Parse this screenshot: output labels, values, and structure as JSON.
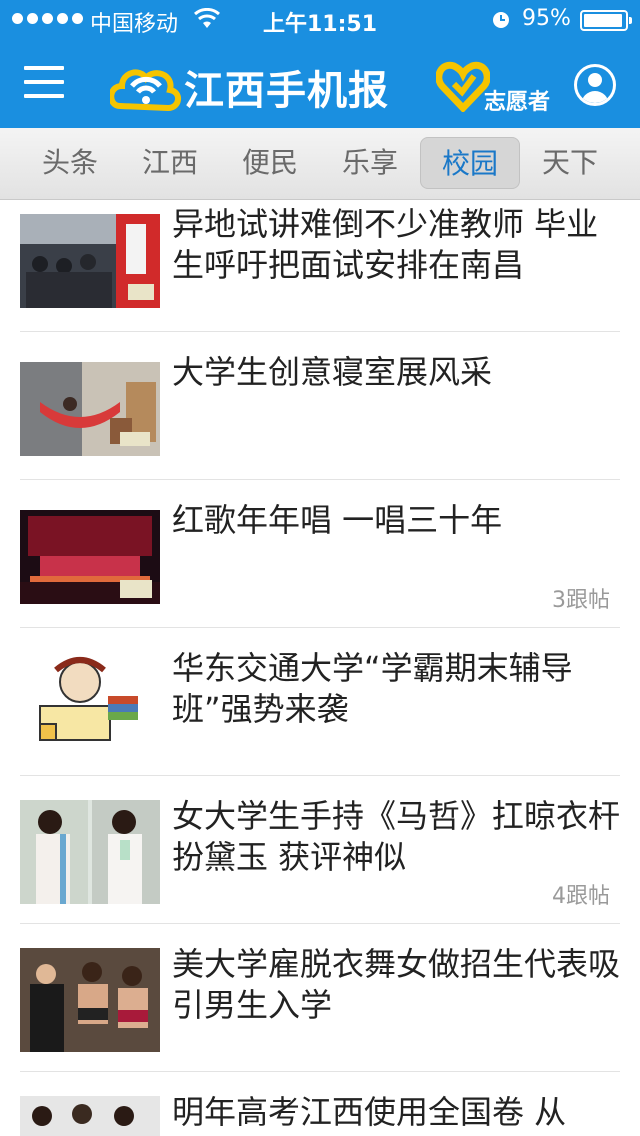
{
  "status_bar": {
    "carrier": "中国移动",
    "time": "上午11:51",
    "battery": "95%",
    "battery_level": 0.95
  },
  "header": {
    "app_name": "江西手机报",
    "volunteer_label": "志愿者",
    "icons": [
      "menu-icon",
      "logo-icon",
      "volunteer-heart-icon",
      "user-icon"
    ],
    "colors": {
      "bar": "#1a8fe0",
      "logo_accent": "#f5c400"
    }
  },
  "tabs": [
    {
      "label": "头条",
      "active": false
    },
    {
      "label": "江西",
      "active": false
    },
    {
      "label": "便民",
      "active": false
    },
    {
      "label": "乐享",
      "active": false
    },
    {
      "label": "校园",
      "active": true
    },
    {
      "label": "天下",
      "active": false
    }
  ],
  "news": [
    {
      "title": "异地试讲难倒不少准教师 毕业生呼吁把面试安排在南昌",
      "replies": ""
    },
    {
      "title": "大学生创意寝室展风采",
      "replies": ""
    },
    {
      "title": "红歌年年唱 一唱三十年",
      "replies": "3跟帖"
    },
    {
      "title": "华东交通大学“学霸期末辅导班”强势来袭",
      "replies": ""
    },
    {
      "title": "女大学生手持《马哲》扛晾衣杆扮黛玉 获评神似",
      "replies": "4跟帖"
    },
    {
      "title": "美大学雇脱衣舞女做招生代表吸引男生入学",
      "replies": ""
    },
    {
      "title": "明年高考江西使用全国卷 从",
      "replies": ""
    }
  ]
}
